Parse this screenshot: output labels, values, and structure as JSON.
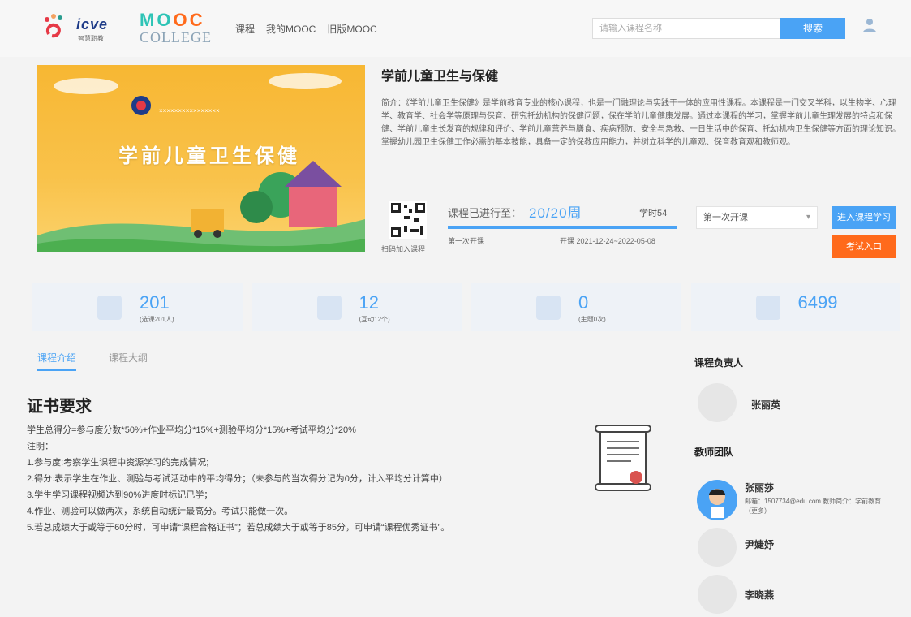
{
  "header": {
    "logo_icve": "icve",
    "logo_icve_sub": "智慧职教",
    "logo_mooc": "MOOC",
    "logo_college": "COLLEGE",
    "nav": [
      "课程",
      "我的MOOC",
      "旧版MOOC"
    ],
    "search_placeholder": "请输入课程名称",
    "search_button": "搜索"
  },
  "course": {
    "cover_school": "××××××××××××××××",
    "cover_title": "学前儿童卫生保健",
    "title": "学前儿童卫生与保健",
    "description": "简介：《学前儿童卫生保健》是学前教育专业的核心课程，也是一门融理论与实践于一体的应用性课程。本课程是一门交叉学科，以生物学、心理学、教育学、社会学等原理与保育、研究托幼机构的保健问题，保在学前儿童健康发展。通过本课程的学习，掌握学前儿童生理发展的特点和保健、学前儿童生长发育的规律和评价、学前儿童营养与膳食、疾病预防、安全与急救、一日生活中的保育、托幼机构卫生保健等方面的理论知识。掌握幼儿园卫生保健工作必需的基本技能，具备一定的保教应用能力，并树立科学的儿童观、保育教育观和教师观。",
    "qr_label": "扫码加入课程",
    "progress_label": "课程已进行至：",
    "progress_value": "20/20周",
    "progress_fraction": 1.0,
    "hours_label": "学时54",
    "session_label": "第一次开课",
    "date_range": "开课 2021-12-24~2022-05-08",
    "session_select": "第一次开课",
    "enter_button": "进入课程学习",
    "exam_button": "考试入口"
  },
  "stats": [
    {
      "value": "201",
      "sub": "(选课201人)"
    },
    {
      "value": "12",
      "sub": "(互动12个)"
    },
    {
      "value": "0",
      "sub": "(主题0次)"
    },
    {
      "value": "6499",
      "sub": ""
    }
  ],
  "tabs": [
    "课程介绍",
    "课程大纲"
  ],
  "certificate": {
    "title": "证书要求",
    "lines": [
      "学生总得分=参与度分数*50%+作业平均分*15%+测验平均分*15%+考试平均分*20%",
      "注明：",
      "1.参与度:考察学生课程中资源学习的完成情况;",
      "2.得分:表示学生在作业、测验与考试活动中的平均得分；（未参与的当次得分记为0分，计入平均分计算中）",
      "3.学生学习课程视频达到90%进度时标记已学；",
      "4.作业、测验可以做两次，系统自动统计最高分。考试只能做一次。",
      "5.若总成绩大于或等于60分时，可申请“课程合格证书”；若总成绩大于或等于85分，可申请“课程优秀证书”。"
    ]
  },
  "sidebar": {
    "leader_heading": "课程负责人",
    "leader_name": "张丽英",
    "team_heading": "教师团队",
    "team": [
      {
        "name": "张丽莎",
        "detail": "邮箱：1507734@edu.com 教师简介：学前教育 （更多）"
      },
      {
        "name": "尹婕妤",
        "detail": ""
      },
      {
        "name": "李晓燕",
        "detail": ""
      }
    ]
  },
  "colors": {
    "accent": "#4aa3f5",
    "orange": "#ff6a1b",
    "mooc_colors": [
      "#2ec4b6",
      "#2ec4b6",
      "#ff6a1b",
      "#ff6a1b"
    ]
  }
}
